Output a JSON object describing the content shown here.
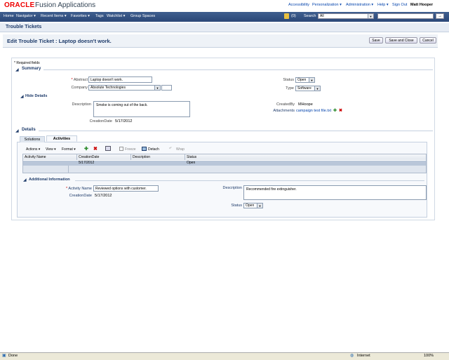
{
  "header": {
    "logo": "ORACLE",
    "product": "Fusion Applications",
    "links": [
      "Accessibility",
      "Personalization ▾",
      "Administration ▾",
      "Help ▾",
      "Sign Out"
    ],
    "user": "Matt Hooper"
  },
  "nav": {
    "items": [
      "Home",
      "Navigator ▾",
      "Recent Items ▾",
      "Favorites ▾",
      "Tags",
      "Watchlist ▾",
      "Group Spaces"
    ],
    "notifications": "(0)",
    "search_label": "Search",
    "search_scope": "All",
    "search_go": "→"
  },
  "page": {
    "title": "Trouble Tickets",
    "edit_title": "Edit Trouble Ticket : Laptop doesn't work.",
    "buttons": {
      "save": "Save",
      "save_close": "Save and Close",
      "cancel": "Cancel"
    },
    "required_note": "* Required fields"
  },
  "summary": {
    "header": "Summary",
    "abstract_label": "Abstract",
    "abstract_value": "Laptop doesn't work.",
    "company_label": "Company",
    "company_value": "Absolute Technologies",
    "status_label": "Status",
    "status_value": "Open",
    "type_label": "Type",
    "type_value": "Software",
    "hide_details": "Hide Details",
    "description_label": "Description",
    "description_value": "Smoke is coming out of the back.",
    "created_by_label": "CreatedBy",
    "created_by_value": "MHoope",
    "attachments_label": "Attachments",
    "attachments_value": "campaign test file.txt",
    "creation_date_label": "CreationDate",
    "creation_date_value": "5/17/2012"
  },
  "details": {
    "header": "Details",
    "tabs": [
      "Solutions",
      "Activities"
    ],
    "toolbar": {
      "actions": "Actions ▾",
      "view": "View ▾",
      "format": "Format ▾",
      "freeze": "Freeze",
      "detach": "Detach",
      "wrap": "Wrap"
    },
    "columns": [
      "Activity Name",
      "CreationDate",
      "Description",
      "Status"
    ],
    "rows": [
      {
        "activity_name": "",
        "creation_date": "5/17/2012",
        "description": "",
        "status": "Open"
      }
    ]
  },
  "additional": {
    "header": "Additional Information",
    "activity_name_label": "Activity Name",
    "activity_name_value": "Reviewed options with customer.",
    "creation_date_label": "CreationDate",
    "creation_date_value": "5/17/2012",
    "description_label": "Description",
    "description_value": "Recommended fire extinguisher.",
    "status_label": "Status",
    "status_value": "Open"
  },
  "statusbar": {
    "left": "Done",
    "zone": "Internet",
    "zoom": "100%"
  },
  "colors": {
    "brand_red": "#e00000",
    "nav_blue": "#2a4777",
    "title_blue": "#1f3c6b"
  }
}
